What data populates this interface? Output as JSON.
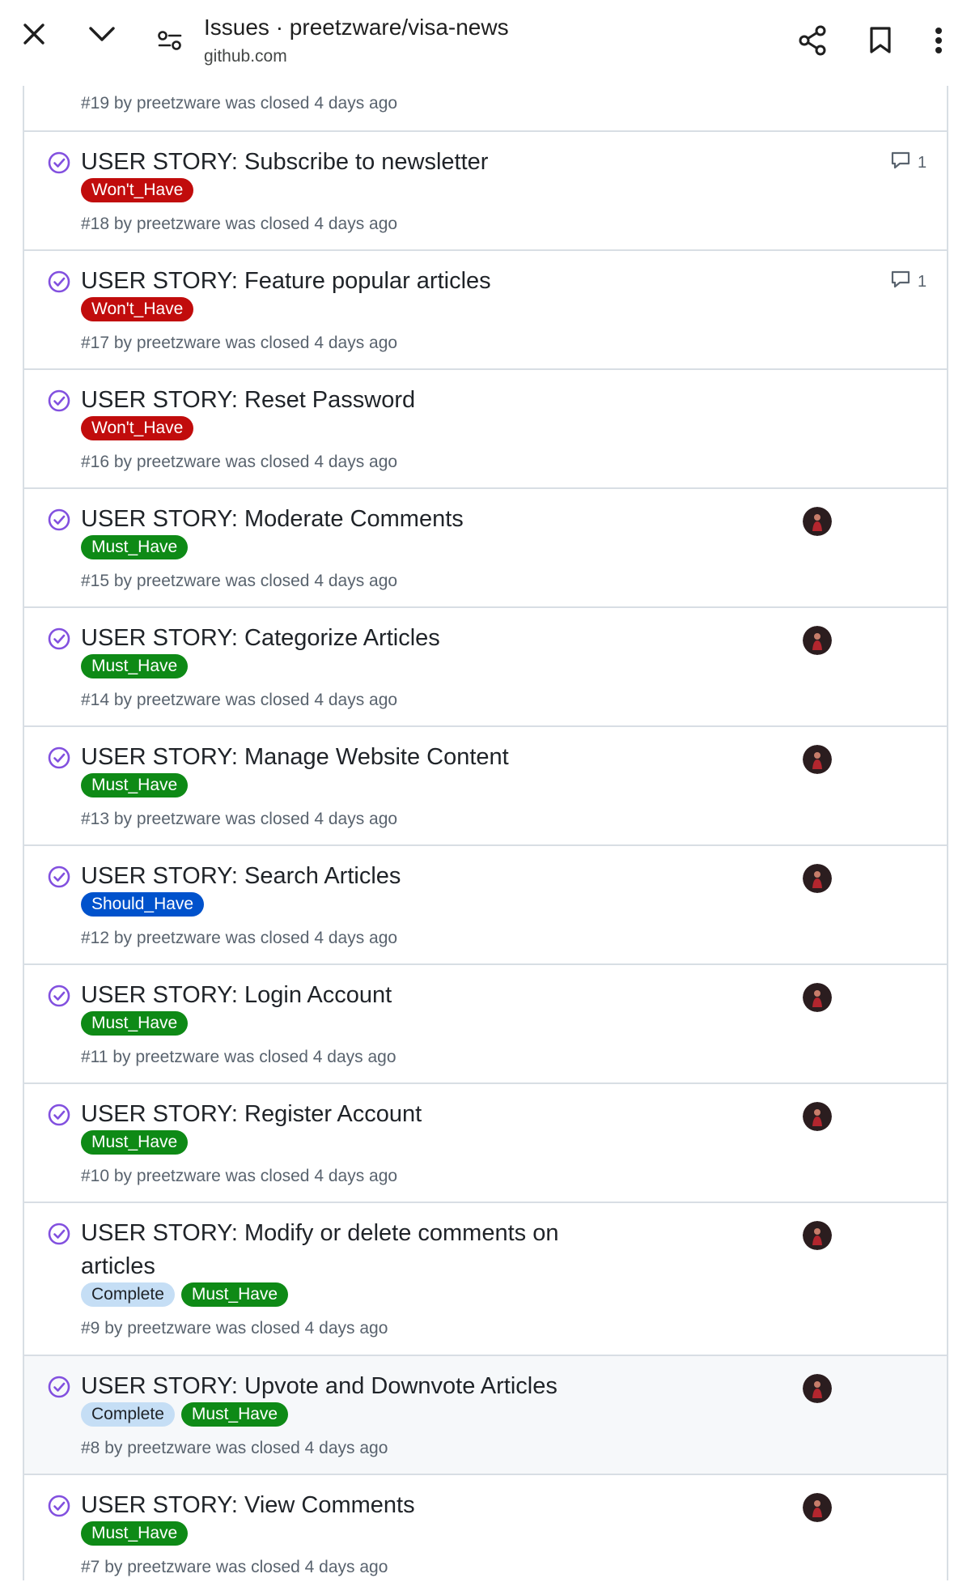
{
  "browser": {
    "title": "Issues · preetzware/visa-news",
    "url": "github.com",
    "icons": [
      "close-icon",
      "chevron-down-icon",
      "site-settings-icon",
      "share-icon",
      "bookmark-icon",
      "more-vert-icon"
    ]
  },
  "colors": {
    "closed_purple": "#8250df",
    "wont_have": "#c10c0c",
    "must_have": "#0e8a16",
    "should_have": "#0052cc",
    "complete": "#c5def5"
  },
  "partial_top": {
    "meta": "#19 by preetzware was closed 4 days ago"
  },
  "issues": [
    {
      "title": "USER STORY: Subscribe to newsletter",
      "labels": [
        {
          "text": "Won't_Have",
          "color": "#c10c0c"
        }
      ],
      "meta": "#18 by preetzware was closed 4 days ago",
      "comments": "1"
    },
    {
      "title": "USER STORY: Feature popular articles",
      "labels": [
        {
          "text": "Won't_Have",
          "color": "#c10c0c"
        }
      ],
      "meta": "#17 by preetzware was closed 4 days ago",
      "comments": "1"
    },
    {
      "title": "USER STORY: Reset Password",
      "labels": [
        {
          "text": "Won't_Have",
          "color": "#c10c0c"
        }
      ],
      "meta": "#16 by preetzware was closed 4 days ago"
    },
    {
      "title": "USER STORY: Moderate Comments",
      "labels": [
        {
          "text": "Must_Have",
          "color": "#0e8a16"
        }
      ],
      "meta": "#15 by preetzware was closed 4 days ago",
      "avatar": true
    },
    {
      "title": "USER STORY: Categorize Articles",
      "labels": [
        {
          "text": "Must_Have",
          "color": "#0e8a16"
        }
      ],
      "meta": "#14 by preetzware was closed 4 days ago",
      "avatar": true
    },
    {
      "title": "USER STORY: Manage Website Content",
      "labels": [
        {
          "text": "Must_Have",
          "color": "#0e8a16"
        }
      ],
      "meta": "#13 by preetzware was closed 4 days ago",
      "avatar": true
    },
    {
      "title": "USER STORY: Search Articles",
      "labels": [
        {
          "text": "Should_Have",
          "color": "#0052cc"
        }
      ],
      "meta": "#12 by preetzware was closed 4 days ago",
      "avatar": true
    },
    {
      "title": "USER STORY: Login Account",
      "labels": [
        {
          "text": "Must_Have",
          "color": "#0e8a16"
        }
      ],
      "meta": "#11 by preetzware was closed 4 days ago",
      "avatar": true
    },
    {
      "title": "USER STORY: Register Account",
      "labels": [
        {
          "text": "Must_Have",
          "color": "#0e8a16"
        }
      ],
      "meta": "#10 by preetzware was closed 4 days ago",
      "avatar": true
    },
    {
      "title": "USER STORY: Modify or delete comments on articles",
      "labels": [
        {
          "text": "Complete",
          "color": "#c5def5"
        },
        {
          "text": "Must_Have",
          "color": "#0e8a16"
        }
      ],
      "meta": "#9 by preetzware was closed 4 days ago",
      "avatar": true
    },
    {
      "title": "USER STORY: Upvote and Downvote Articles",
      "labels": [
        {
          "text": "Complete",
          "color": "#c5def5"
        },
        {
          "text": "Must_Have",
          "color": "#0e8a16"
        }
      ],
      "meta": "#8 by preetzware was closed 4 days ago",
      "avatar": true
    },
    {
      "title": "USER STORY: View Comments",
      "labels": [
        {
          "text": "Must_Have",
          "color": "#0e8a16"
        }
      ],
      "meta": "#7 by preetzware was closed 4 days ago",
      "avatar": true
    }
  ]
}
